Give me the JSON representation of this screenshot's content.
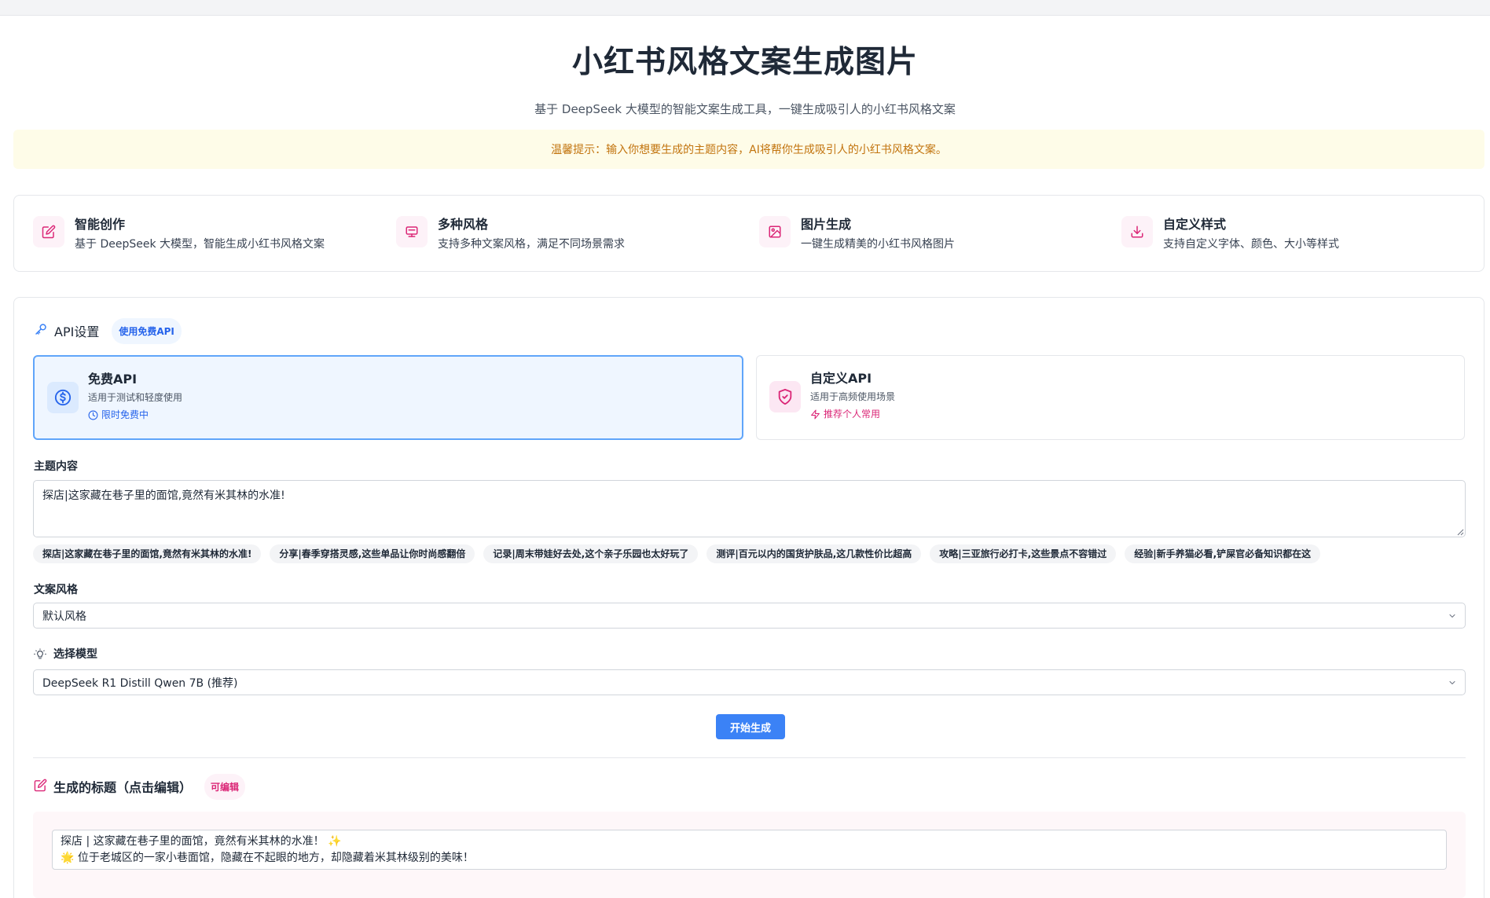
{
  "header": {
    "title": "小红书风格文案生成图片",
    "subtitle": "基于 DeepSeek 大模型的智能文案生成工具，一键生成吸引人的小红书风格文案",
    "tip": "温馨提示：输入你想要生成的主题内容，AI将帮你生成吸引人的小红书风格文案。"
  },
  "features": [
    {
      "title": "智能创作",
      "desc": "基于 DeepSeek 大模型，智能生成小红书风格文案",
      "icon": "edit-icon"
    },
    {
      "title": "多种风格",
      "desc": "支持多种文案风格，满足不同场景需求",
      "icon": "monitor-icon"
    },
    {
      "title": "图片生成",
      "desc": "一键生成精美的小红书风格图片",
      "icon": "image-icon"
    },
    {
      "title": "自定义样式",
      "desc": "支持自定义字体、颜色、大小等样式",
      "icon": "download-icon"
    }
  ],
  "api": {
    "title": "API设置",
    "badge": "使用免费API",
    "free": {
      "name": "免费API",
      "desc": "适用于测试和轻度使用",
      "tag": "限时免费中",
      "icon": "dollar-icon"
    },
    "custom": {
      "name": "自定义API",
      "desc": "适用于高频使用场景",
      "tag": "推荐个人常用",
      "icon": "shield-icon"
    }
  },
  "topic": {
    "label": "主题内容",
    "value": "探店|这家藏在巷子里的面馆,竟然有米其林的水准!",
    "examples": [
      "探店|这家藏在巷子里的面馆,竟然有米其林的水准!",
      "分享|春季穿搭灵感,这些单品让你时尚感翻倍",
      "记录|周末带娃好去处,这个亲子乐园也太好玩了",
      "测评|百元以内的国货护肤品,这几款性价比超高",
      "攻略|三亚旅行必打卡,这些景点不容错过",
      "经验|新手养猫必看,铲屎官必备知识都在这"
    ]
  },
  "style": {
    "label": "文案风格",
    "selected": "默认风格"
  },
  "model": {
    "label": "选择模型",
    "selected": "DeepSeek R1 Distill Qwen 7B (推荐)"
  },
  "generate_label": "开始生成",
  "result": {
    "title": "生成的标题（点击编辑）",
    "badge": "可编辑",
    "line1": "探店 | 这家藏在巷子里的面馆，竟然有米其林的水准！ ✨",
    "line2": "🌟 位于老城区的一家小巷面馆，隐藏在不起眼的地方，却隐藏着米其林级别的美味！"
  },
  "colors": {
    "accent_blue": "#3b82f6",
    "accent_pink": "#db2777",
    "tip_text": "#c2740e"
  }
}
